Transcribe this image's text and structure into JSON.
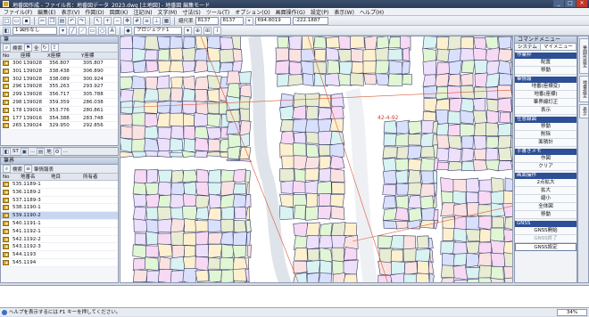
{
  "window": {
    "title": "地番図作成 - ファイル名：地番図データ_2023.dwg [土地図] - 地番図 編集モード"
  },
  "menu": [
    "ファイル(F)",
    "編集(E)",
    "表示(V)",
    "作図(D)",
    "図面(K)",
    "注記(N)",
    "文字(M)",
    "寸法(S)",
    "ツール(T)",
    "オプション(O)",
    "画面操作(G)",
    "設定(P)",
    "表示(W)",
    "ヘルプ(H)"
  ],
  "toolbar": {
    "layer_select": "1 図形なし",
    "project_select": "プロジェクト1",
    "scale_label": "縮尺率",
    "scale_value": "8137",
    "scale_value2": "8137",
    "x_coord": "694.8019",
    "y_coord": "-222.1887"
  },
  "left_top": {
    "title": "筆",
    "search_label": "検索",
    "flag_label": "全",
    "columns": [
      "No",
      "座標",
      "X座標",
      "Y座標"
    ],
    "rows": [
      {
        "no": "300",
        "id": "139028",
        "x": "356.807",
        "y": "305.807"
      },
      {
        "no": "301",
        "id": "139028",
        "x": "338.438",
        "y": "306.890"
      },
      {
        "no": "302",
        "id": "139028",
        "x": "338.089",
        "y": "300.924"
      },
      {
        "no": "296",
        "id": "139028",
        "x": "355.263",
        "y": "293.927"
      },
      {
        "no": "299",
        "id": "139028",
        "x": "356.717",
        "y": "305.788"
      },
      {
        "no": "298",
        "id": "139028",
        "x": "359.359",
        "y": "286.038"
      },
      {
        "no": "178",
        "id": "139016",
        "x": "353.776",
        "y": "280.861"
      },
      {
        "no": "177",
        "id": "139016",
        "x": "354.388",
        "y": "283.748"
      },
      {
        "no": "265",
        "id": "139024",
        "x": "329.950",
        "y": "292.856"
      }
    ]
  },
  "left_tabs": [
    "ST",
    "...",
    "地",
    "..."
  ],
  "left_bottom": {
    "title": "筆界",
    "search_label": "検索",
    "list_label": "筆情報表",
    "columns": [
      "No",
      "地番名",
      "地目",
      "所有者"
    ],
    "rows": [
      {
        "no": "535.1189-1"
      },
      {
        "no": "536.1189-2"
      },
      {
        "no": "537.1189-3"
      },
      {
        "no": "538.1190-1"
      },
      {
        "no": "539.1190-2"
      },
      {
        "no": "540.1191-1"
      },
      {
        "no": "541.1192-1"
      },
      {
        "no": "542.1192-2"
      },
      {
        "no": "543.1192-3"
      },
      {
        "no": "544.1193"
      },
      {
        "no": "545.1194"
      }
    ],
    "selected_index": 4
  },
  "map": {
    "annotation": "42-4-92",
    "parcel_colors": [
      "#f7d9f3",
      "#d9e0fb",
      "#e1f6d4",
      "#fdf0cf",
      "#ece0fa",
      "#d9f2f2",
      "#fbe2e2",
      "#e7ecd2"
    ]
  },
  "command_menu": {
    "title": "コマンドメニュー",
    "tabs": [
      "システム",
      "マイメニュー"
    ],
    "sections": [
      {
        "label": "作業枠",
        "items": [
          "配置",
          "移動"
        ]
      },
      {
        "label": "筆情報",
        "items": [
          "地番(座標変)",
          "地番(座標)",
          "筆界線訂正",
          "表示"
        ]
      },
      {
        "label": "任意線図",
        "items": [
          "移動",
          "削除",
          "面積計"
        ]
      },
      {
        "label": "手書きメモ",
        "items": [
          "作図",
          "クリア"
        ]
      },
      {
        "label": "画面操作",
        "items": [
          "2点拡大",
          "拡大",
          "縮小",
          "全体図",
          "移動"
        ]
      },
      {
        "label": "GNSS",
        "items": [
          "GNSS開始",
          "GNSS終了",
          "GNSS設定"
        ]
      }
    ]
  },
  "side_tabs": [
    "筆図形設定",
    "地番設定",
    "表示"
  ],
  "status": {
    "text": "ヘルプを表示するには F1 キーを押してください。",
    "zoom": "34%"
  }
}
